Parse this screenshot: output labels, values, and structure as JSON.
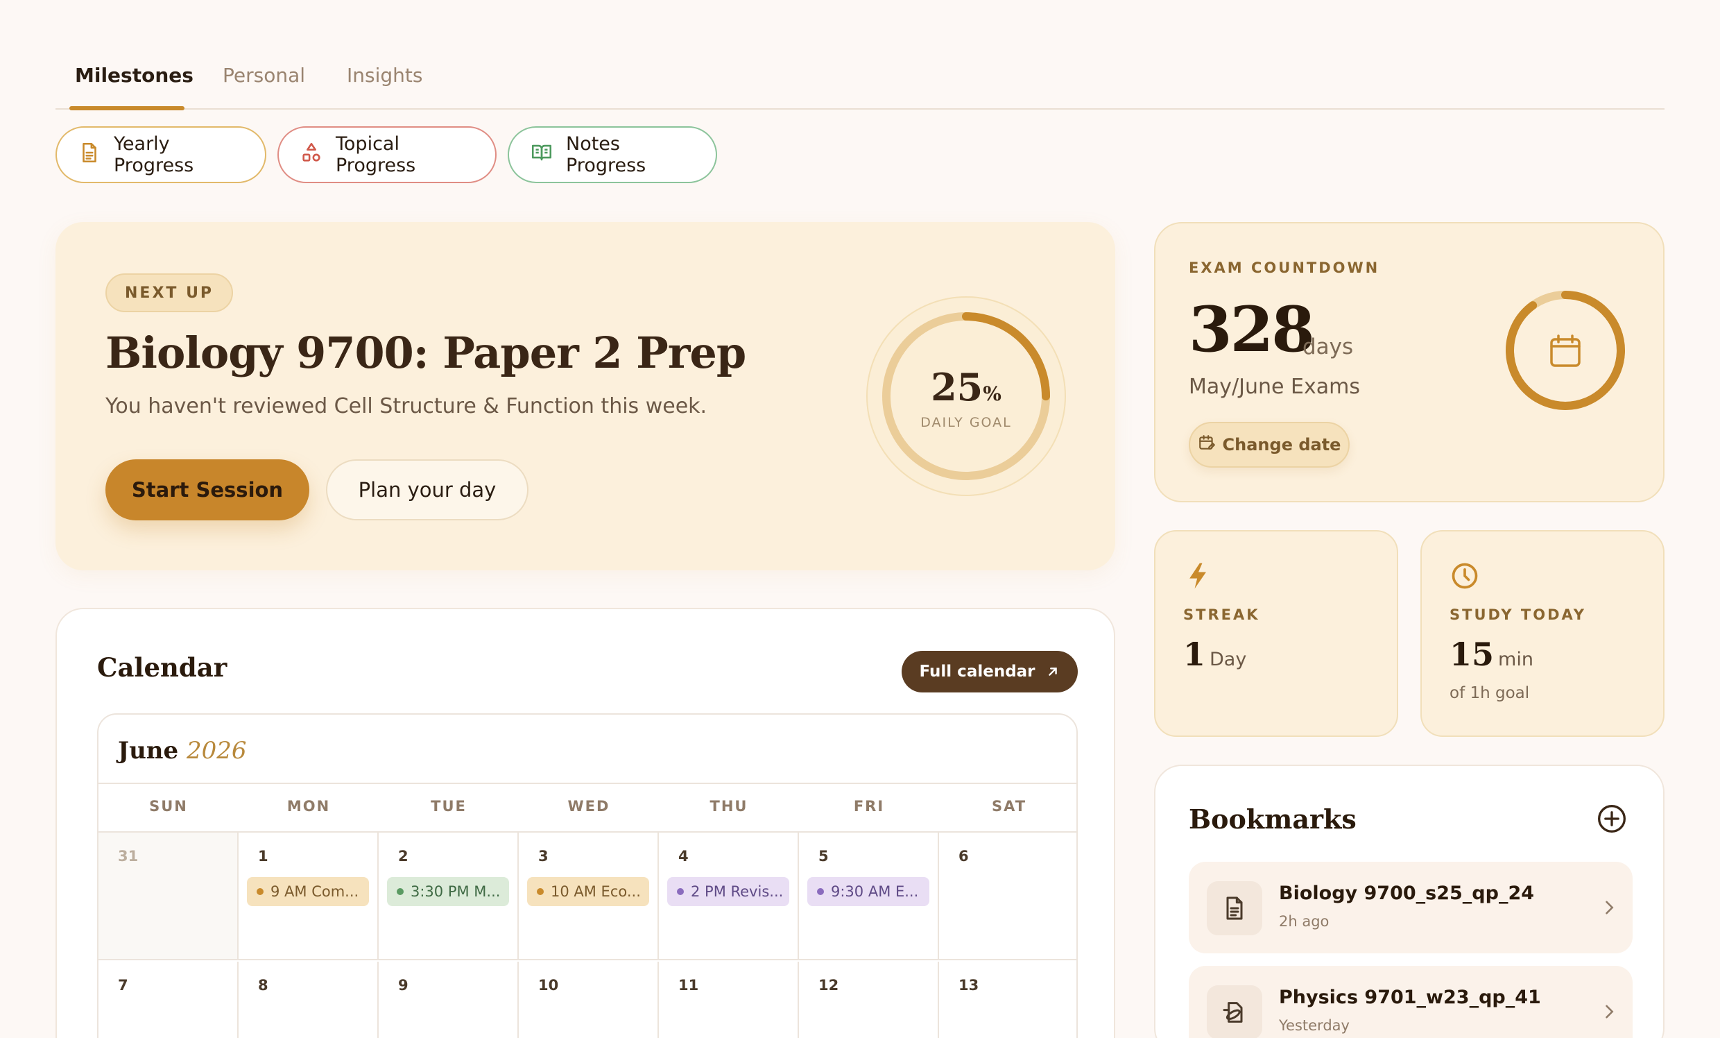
{
  "tabs": [
    {
      "label": "Milestones"
    },
    {
      "label": "Personal"
    },
    {
      "label": "Insights"
    }
  ],
  "pills": {
    "yearly": {
      "label": "Yearly Progress",
      "icon": "document-icon",
      "color": "#c98a2b"
    },
    "topical": {
      "label": "Topical Progress",
      "icon": "shapes-icon",
      "color": "#d0584a"
    },
    "notes": {
      "label": "Notes Progress",
      "icon": "book-open-icon",
      "color": "#4d9a5e"
    }
  },
  "hero": {
    "badge": "NEXT UP",
    "title": "Biology 9700: Paper 2 Prep",
    "subtitle": "You haven't reviewed Cell Structure & Function this week.",
    "start_label": "Start Session",
    "plan_label": "Plan your day",
    "goal_value": "25",
    "goal_unit": "%",
    "goal_label": "DAILY GOAL",
    "goal_fraction": 0.25
  },
  "countdown": {
    "label": "EXAM COUNTDOWN",
    "days": "328",
    "unit": "days",
    "exam": "May/June Exams",
    "change_label": "Change date",
    "ring_fraction": 0.9
  },
  "streak": {
    "label": "STREAK",
    "value": "1",
    "unit": "Day",
    "icon": "lightning-icon"
  },
  "study": {
    "label": "STUDY TODAY",
    "value": "15",
    "unit": "min",
    "sub": "of 1h goal",
    "icon": "clock-icon"
  },
  "calendar": {
    "title": "Calendar",
    "full_label": "Full calendar",
    "month": "June",
    "year": "2026",
    "weekdays": [
      "SUN",
      "MON",
      "TUE",
      "WED",
      "THU",
      "FRI",
      "SAT"
    ],
    "week1": [
      {
        "day": "31",
        "dim": true
      },
      {
        "day": "1",
        "event": "9 AM Com...",
        "color": "orange"
      },
      {
        "day": "2",
        "event": "3:30 PM M...",
        "color": "green"
      },
      {
        "day": "3",
        "event": "10 AM Eco...",
        "color": "orange"
      },
      {
        "day": "4",
        "event": "2 PM Revis...",
        "color": "purple"
      },
      {
        "day": "5",
        "event": "9:30 AM E...",
        "color": "purple"
      },
      {
        "day": "6"
      }
    ],
    "week2": [
      {
        "day": "7"
      },
      {
        "day": "8"
      },
      {
        "day": "9"
      },
      {
        "day": "10"
      },
      {
        "day": "11"
      },
      {
        "day": "12"
      },
      {
        "day": "13"
      }
    ]
  },
  "bookmarks": {
    "title": "Bookmarks",
    "items": [
      {
        "name": "Biology 9700_s25_qp_24",
        "time": "2h ago",
        "icon": "document-icon"
      },
      {
        "name": "Physics 9701_w23_qp_41",
        "time": "Yesterday",
        "icon": "atom-document-icon"
      }
    ]
  }
}
